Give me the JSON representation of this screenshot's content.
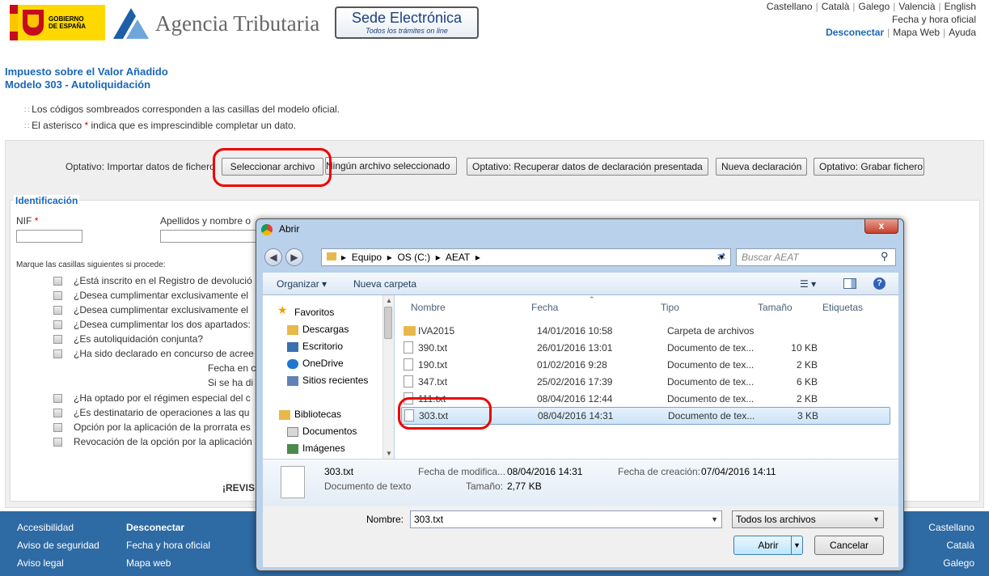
{
  "header": {
    "gob_label": "GOBIERNO\nDE ESPAÑA",
    "agency": "Agencia Tributaria",
    "sede_title": "Sede Electrónica",
    "sede_subtitle": "Todos los trámites on line",
    "languages": [
      "Castellano",
      "Català",
      "Galego",
      "Valencià",
      "English"
    ],
    "date_time": "Fecha y hora oficial",
    "disconnect": "Desconectar",
    "sitemap": "Mapa Web",
    "help": "Ayuda"
  },
  "page": {
    "title_line1": "Impuesto sobre el Valor Añadido",
    "title_line2": "Modelo 303 - Autoliquidación",
    "note1": "Los códigos sombreados corresponden a las casillas del modelo oficial.",
    "note2_a": "El asterisco ",
    "note2_star": "*",
    "note2_b": " indica que es imprescindible completar un dato."
  },
  "actions": {
    "import_label": "Optativo: Importar datos de fichero",
    "select_file": "Seleccionar archivo",
    "no_file": "Ningún archivo seleccionado",
    "recover": "Optativo: Recuperar datos de declaración presentada",
    "new_decl": "Nueva declaración",
    "save_file": "Optativo: Grabar fichero"
  },
  "form": {
    "section": "Identificación",
    "nif_label": "NIF",
    "name_label": "Apellidos y nombre o",
    "req": "*",
    "mark_label": "Marque las casillas siguientes si procede:",
    "checks": [
      "¿Está inscrito en el Registro de devolució",
      "¿Desea cumplimentar exclusivamente el",
      "¿Desea cumplimentar exclusivamente el",
      "¿Desea cumplimentar los dos apartados:",
      "¿Es autoliquidación conjunta?",
      "¿Ha sido declarado en concurso de acree"
    ],
    "fecha_label": "Fecha en c",
    "si_label": "Si se ha di",
    "checks2": [
      "¿Ha optado por el régimen especial del c",
      "¿Es destinatario de operaciones a las qu",
      "Opción por la aplicación de la prorrata es",
      "Revocación de la opción por la aplicación"
    ],
    "revis": "¡REVIS"
  },
  "footer": {
    "col1": [
      "Accesibilidad",
      "Aviso de seguridad",
      "Aviso legal"
    ],
    "col2": [
      "Desconectar",
      "Fecha y hora oficial",
      "Mapa web"
    ],
    "col3": [
      "Castellano",
      "Català",
      "Galego"
    ]
  },
  "dialog": {
    "title": "Abrir",
    "close": "x",
    "path": [
      "Equipo",
      "OS (C:)",
      "AEAT"
    ],
    "search_placeholder": "Buscar AEAT",
    "organize": "Organizar",
    "new_folder": "Nueva carpeta",
    "nav": {
      "favorites": "Favoritos",
      "items": [
        "Descargas",
        "Escritorio",
        "OneDrive",
        "Sitios recientes"
      ],
      "libraries": "Bibliotecas",
      "lib_items": [
        "Documentos",
        "Imágenes"
      ]
    },
    "columns": [
      "Nombre",
      "Fecha",
      "Tipo",
      "Tamaño",
      "Etiquetas"
    ],
    "files": [
      {
        "name": "IVA2015",
        "date": "14/01/2016 10:58",
        "type": "Carpeta de archivos",
        "size": "",
        "folder": true
      },
      {
        "name": "390.txt",
        "date": "26/01/2016 13:01",
        "type": "Documento de tex...",
        "size": "10 KB"
      },
      {
        "name": "190.txt",
        "date": "01/02/2016 9:28",
        "type": "Documento de tex...",
        "size": "2 KB"
      },
      {
        "name": "347.txt",
        "date": "25/02/2016 17:39",
        "type": "Documento de tex...",
        "size": "6 KB"
      },
      {
        "name": "111.txt",
        "date": "08/04/2016 12:44",
        "type": "Documento de tex...",
        "size": "2 KB"
      },
      {
        "name": "303.txt",
        "date": "08/04/2016 14:31",
        "type": "Documento de tex...",
        "size": "3 KB",
        "selected": true
      }
    ],
    "details": {
      "name": "303.txt",
      "kind": "Documento de texto",
      "modified_label": "Fecha de modifica...",
      "modified": "08/04/2016 14:31",
      "created_label": "Fecha de creación:",
      "created": "07/04/2016 14:11",
      "size_label": "Tamaño:",
      "size": "2,77 KB"
    },
    "filename_label": "Nombre:",
    "filename": "303.txt",
    "filter": "Todos los archivos",
    "open": "Abrir",
    "cancel": "Cancelar"
  },
  "colors": {
    "brand_blue": "#1a66b8",
    "footer": "#2e6aa3",
    "highlight": "#e00000"
  }
}
